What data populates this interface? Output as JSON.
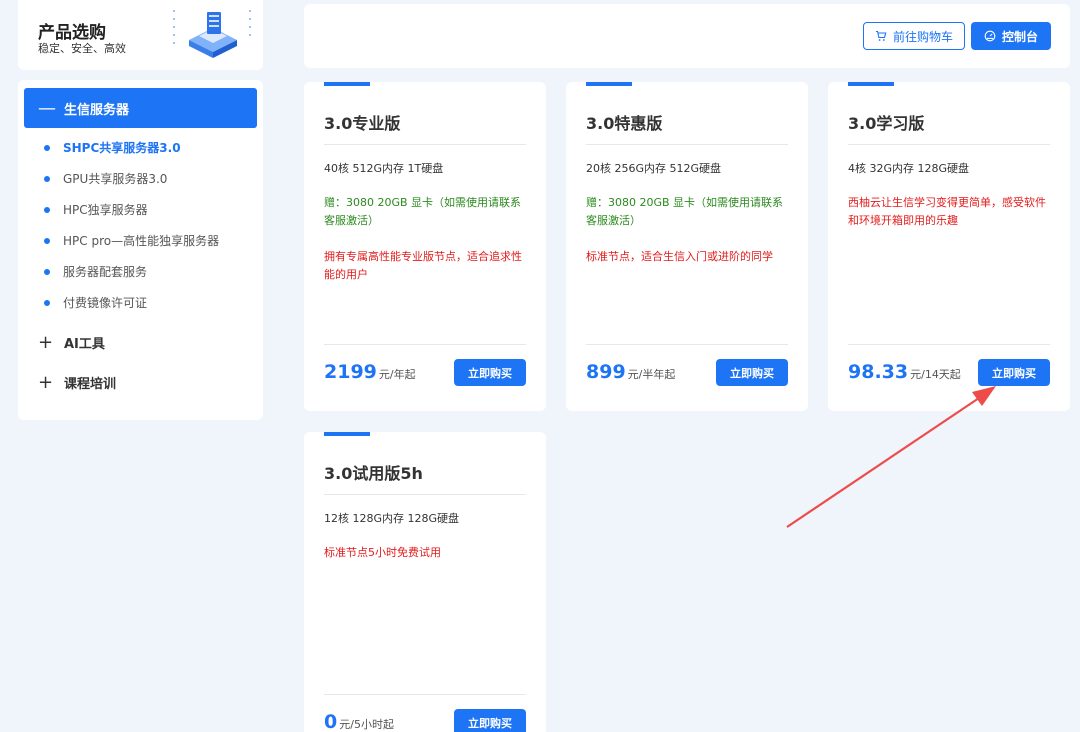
{
  "sidebar": {
    "title": "产品选购",
    "subtitle": "稳定、安全、高效",
    "active_group": {
      "sign": "—",
      "label": "生信服务器"
    },
    "items": [
      {
        "label": "SHPC共享服务器3.0"
      },
      {
        "label": "GPU共享服务器3.0"
      },
      {
        "label": "HPC独享服务器"
      },
      {
        "label": "HPC pro—高性能独享服务器"
      },
      {
        "label": "服务器配套服务"
      },
      {
        "label": "付费镜像许可证"
      }
    ],
    "groups": [
      {
        "sign": "+",
        "label": "AI工具"
      },
      {
        "sign": "+",
        "label": "课程培训"
      }
    ]
  },
  "toolbar": {
    "cart_label": "前往购物车",
    "console_label": "控制台"
  },
  "cards": [
    {
      "name": "3.0专业版",
      "spec": "40核 512G内存 1T硬盘",
      "gift": "赠：3080 20GB 显卡（如需使用请联系客服激活）",
      "desc": "拥有专属高性能专业版节点，适合追求性能的用户",
      "price": "2199",
      "unit": "元/年起",
      "buy_label": "立即购买"
    },
    {
      "name": "3.0特惠版",
      "spec": "20核 256G内存 512G硬盘",
      "gift": "赠：3080 20GB 显卡（如需使用请联系客服激活）",
      "desc": "标准节点，适合生信入门或进阶的同学",
      "price": "899",
      "unit": "元/半年起",
      "buy_label": "立即购买"
    },
    {
      "name": "3.0学习版",
      "spec": "4核 32G内存 128G硬盘",
      "gift": "",
      "desc": "西柚云让生信学习变得更简单，感受软件和环境开箱即用的乐趣",
      "price": "98.33",
      "unit": "元/14天起",
      "buy_label": "立即购买"
    },
    {
      "name": "3.0试用版5h",
      "spec": "12核 128G内存 128G硬盘",
      "gift": "",
      "desc": "标准节点5小时免费试用",
      "price": "0",
      "unit": "元/5小时起",
      "buy_label": "立即购买"
    }
  ],
  "colors": {
    "accent": "#1d74f5",
    "gift": "#2b8a1f",
    "desc": "#e21c1c",
    "annotation_arrow": "#ee4b4b"
  }
}
